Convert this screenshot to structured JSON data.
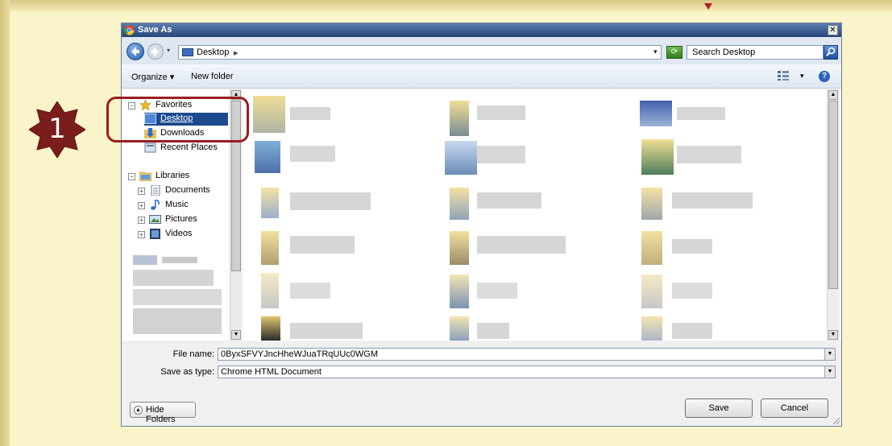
{
  "badge": {
    "number": "1"
  },
  "dialog": {
    "title": "Save As",
    "close_glyph": "✕",
    "address": {
      "location": "Desktop",
      "caret": "▸",
      "dropdown": "▾"
    },
    "search": {
      "placeholder": "Search Desktop"
    },
    "toolbar": {
      "organize": "Organize ▾",
      "new_folder": "New folder",
      "view_dropdown": "▾",
      "help": "?"
    },
    "nav": {
      "favorites": "Favorites",
      "desktop": "Desktop",
      "downloads": "Downloads",
      "recent_places": "Recent Places",
      "libraries": "Libraries",
      "documents": "Documents",
      "music": "Music",
      "pictures": "Pictures",
      "videos": "Videos"
    },
    "form": {
      "file_name_label": "File name:",
      "file_name_value": "0ByxSFVYJncHheWJuaTRqUUc0WGM",
      "save_type_label": "Save as type:",
      "save_type_value": "Chrome HTML Document"
    },
    "buttons": {
      "hide_folders": "Hide Folders",
      "save": "Save",
      "cancel": "Cancel"
    }
  },
  "colors": {
    "background": "#fbf3c9",
    "badge": "#7a1d1d",
    "highlight": "#9a1c20",
    "selection": "#1c4a8e"
  },
  "icons": [
    "chrome-icon",
    "back-icon",
    "forward-icon",
    "desktop-icon",
    "refresh-icon",
    "search-icon",
    "views-icon",
    "help-icon",
    "star-icon",
    "folder-icon",
    "documents-icon",
    "music-icon",
    "pictures-icon",
    "videos-icon"
  ]
}
